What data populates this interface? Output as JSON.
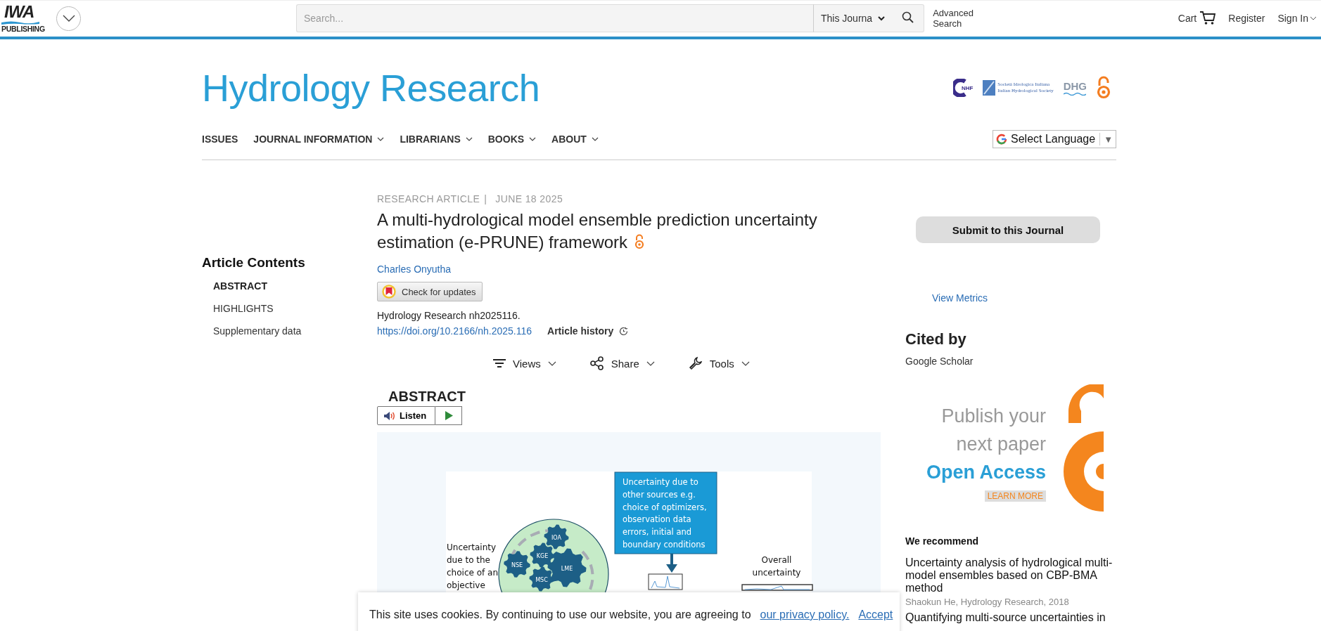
{
  "header": {
    "logo": {
      "top": "IWA",
      "bottom": "PUBLISHING"
    },
    "search": {
      "placeholder": "Search..."
    },
    "scope": "This Journa",
    "advanced_search": "Advanced Search",
    "cart": "Cart",
    "register": "Register",
    "sign_in": "Sign In"
  },
  "journal": {
    "title": "Hydrology Research",
    "partner_logos": [
      {
        "kind": "cnhf",
        "text": "NHF"
      },
      {
        "kind": "sii",
        "lines": [
          "Società Idrologica Italiana",
          "Italian Hydrological Society"
        ]
      },
      {
        "kind": "dhg",
        "text": "DHG"
      },
      {
        "kind": "open_access"
      }
    ]
  },
  "nav": [
    {
      "label": "ISSUES",
      "dropdown": false
    },
    {
      "label": "JOURNAL INFORMATION",
      "dropdown": true
    },
    {
      "label": "LIBRARIANS",
      "dropdown": true
    },
    {
      "label": "BOOKS",
      "dropdown": true
    },
    {
      "label": "ABOUT",
      "dropdown": true
    }
  ],
  "language": {
    "label": "Select Language",
    "arrow": "▼"
  },
  "article_contents": {
    "title": "Article Contents",
    "items": [
      {
        "label": "ABSTRACT",
        "selected": true
      },
      {
        "label": "HIGHLIGHTS",
        "selected": false
      },
      {
        "label": "Supplementary data",
        "selected": false
      }
    ]
  },
  "article": {
    "type": "RESEARCH ARTICLE",
    "separator": "|",
    "date": "JUNE 18 2025",
    "title": "A multi-hydrological model ensemble prediction uncertainty estimation (e-PRUNE) framework",
    "open_access": true,
    "author": "Charles Onyutha",
    "check_updates": "Check for updates",
    "citation": "Hydrology Research nh2025116.",
    "doi": "https://doi.org/10.2166/nh.2025.116",
    "history": "Article history",
    "tools": [
      {
        "label": "Views",
        "kind": "views"
      },
      {
        "label": "Share",
        "kind": "share"
      },
      {
        "label": "Tools",
        "kind": "tools"
      }
    ],
    "abstract_heading": "ABSTRACT",
    "listen": "Listen"
  },
  "graphical_abstract": {
    "callout_lines": [
      "Uncertainty due to",
      "other sources e.g.",
      "choice of optimizers,",
      "observation data",
      "errors, initial and",
      "boundary conditions"
    ],
    "left_label_lines": [
      "Uncertainty",
      "due to the",
      "choice of an",
      "objective"
    ],
    "gears": [
      {
        "label": "IOA",
        "kind": "small"
      },
      {
        "label": "KGE",
        "kind": "small"
      },
      {
        "label": "NSE",
        "kind": "small"
      },
      {
        "label": "LME",
        "kind": "large"
      },
      {
        "label": "MSC",
        "kind": "small"
      }
    ],
    "overall_lines": [
      "Overall",
      "uncertainty"
    ]
  },
  "sidebar": {
    "submit": "Submit to this Journal",
    "metrics": "View Metrics",
    "cited_by": "Cited by",
    "google_scholar": "Google Scholar",
    "ad": {
      "lines": [
        "Publish your",
        "next paper"
      ],
      "highlight": "Open Access",
      "button": "LEARN MORE"
    },
    "recommend_heading": "We recommend",
    "recommendations": [
      {
        "title": "Uncertainty analysis of hydrological multi-model ensembles based on CBP-BMA method",
        "source": "Shaokun He, Hydrology Research, 2018"
      },
      {
        "title": "Quantifying multi-source uncertainties in"
      }
    ]
  },
  "cookie": {
    "text": "This site uses cookies. By continuing to use our website, you are agreeing to",
    "link": "our privacy policy.",
    "accept": "Accept"
  }
}
